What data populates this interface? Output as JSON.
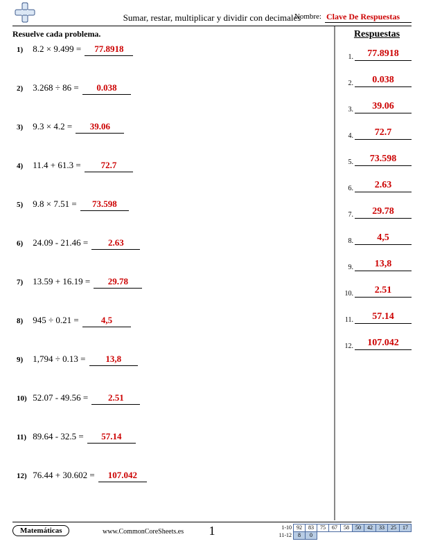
{
  "header": {
    "title": "Sumar, restar, multiplicar y dividir con decimales",
    "name_label": "Nombre:",
    "name_value": "Clave De Respuestas"
  },
  "instruction": "Resuelve cada problema.",
  "problems": [
    {
      "n": "1)",
      "expr": "8.2 × 9.499 =",
      "ans": "77.8918"
    },
    {
      "n": "2)",
      "expr": "3.268 ÷ 86 =",
      "ans": "0.038"
    },
    {
      "n": "3)",
      "expr": "9.3 × 4.2 =",
      "ans": "39.06"
    },
    {
      "n": "4)",
      "expr": "11.4 + 61.3 =",
      "ans": "72.7"
    },
    {
      "n": "5)",
      "expr": "9.8 × 7.51 =",
      "ans": "73.598"
    },
    {
      "n": "6)",
      "expr": "24.09 - 21.46 =",
      "ans": "2.63"
    },
    {
      "n": "7)",
      "expr": "13.59 + 16.19 =",
      "ans": "29.78"
    },
    {
      "n": "8)",
      "expr": "945 ÷ 0.21 =",
      "ans": "4,5"
    },
    {
      "n": "9)",
      "expr": "1,794 ÷ 0.13 =",
      "ans": "13,8"
    },
    {
      "n": "10)",
      "expr": "52.07 - 49.56 =",
      "ans": "2.51"
    },
    {
      "n": "11)",
      "expr": "89.64 - 32.5 =",
      "ans": "57.14"
    },
    {
      "n": "12)",
      "expr": "76.44 + 30.602 =",
      "ans": "107.042"
    }
  ],
  "answers_title": "Respuestas",
  "answers": [
    {
      "n": "1.",
      "v": "77.8918"
    },
    {
      "n": "2.",
      "v": "0.038"
    },
    {
      "n": "3.",
      "v": "39.06"
    },
    {
      "n": "4.",
      "v": "72.7"
    },
    {
      "n": "5.",
      "v": "73.598"
    },
    {
      "n": "6.",
      "v": "2.63"
    },
    {
      "n": "7.",
      "v": "29.78"
    },
    {
      "n": "8.",
      "v": "4,5"
    },
    {
      "n": "9.",
      "v": "13,8"
    },
    {
      "n": "10.",
      "v": "2.51"
    },
    {
      "n": "11.",
      "v": "57.14"
    },
    {
      "n": "12.",
      "v": "107.042"
    }
  ],
  "footer": {
    "subject": "Matemáticas",
    "website": "www.CommonCoreSheets.es",
    "page_number": "1",
    "score": {
      "row1_label": "1-10",
      "row1": [
        "92",
        "83",
        "75",
        "67",
        "58",
        "50",
        "42",
        "33",
        "25",
        "17"
      ],
      "row2_label": "11-12",
      "row2": [
        "8",
        "0"
      ]
    }
  }
}
